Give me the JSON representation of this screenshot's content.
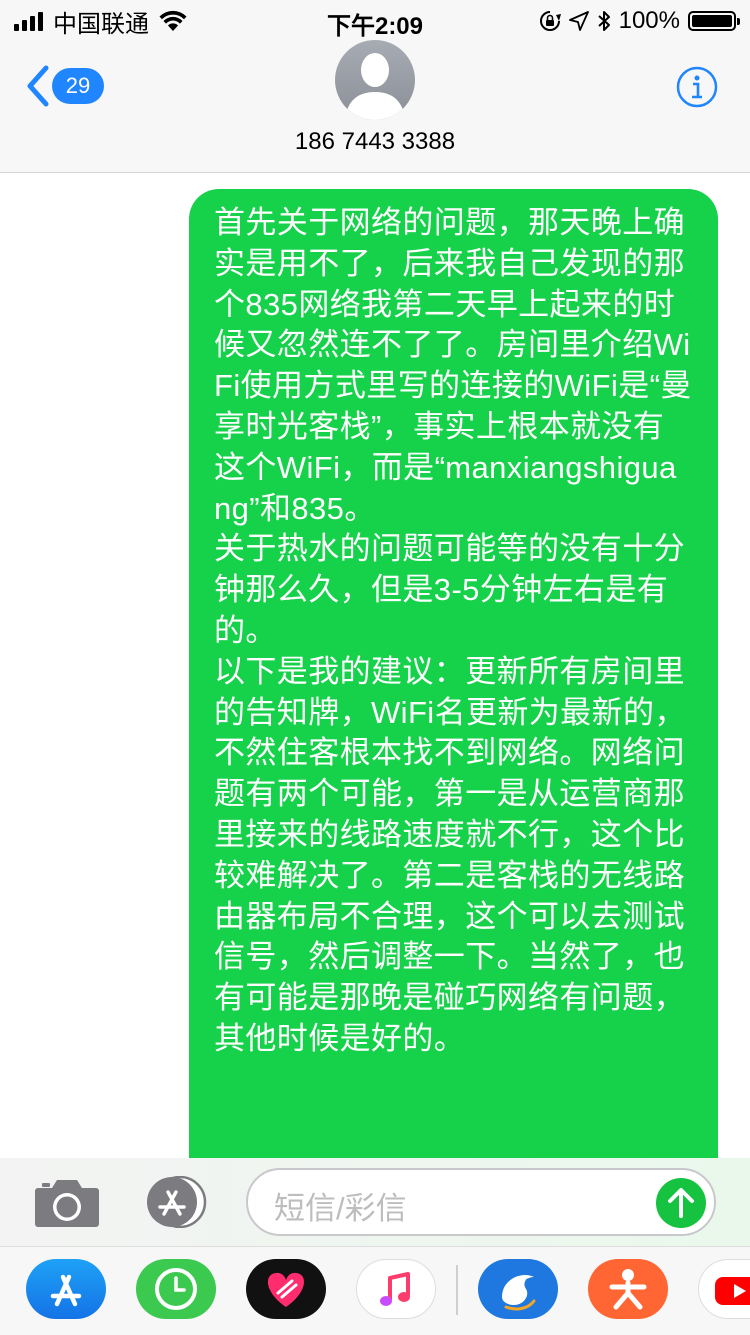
{
  "status_bar": {
    "carrier": "中国联通",
    "time": "下午2:09",
    "battery_percent": "100%"
  },
  "header": {
    "back_count": "29",
    "contact": "186 7443 3388"
  },
  "message": {
    "text": "首先关于网络的问题，那天晚上确实是用不了，后来我自己发现的那个835网络我第二天早上起来的时候又忽然连不了了。房间里介绍WiFi使用方式里写的连接的WiFi是“曼享时光客栈”，事实上根本就没有这个WiFi，而是“manxiangshiguang”和835。\n关于热水的问题可能等的没有十分钟那么久，但是3-5分钟左右是有的。\n以下是我的建议：更新所有房间里的告知牌，WiFi名更新为最新的，不然住客根本找不到网络。网络问题有两个可能，第一是从运营商那里接来的线路速度就不行，这个比较难解决了。第二是客栈的无线路由器布局不合理，这个可以去测试信号，然后调整一下。当然了，也有可能是那晚是碰巧网络有问题，其他时候是好的。",
    "bubble_color": "#16d14a"
  },
  "input": {
    "placeholder": "短信/彩信"
  },
  "app_drawer": {
    "apps": [
      "app-store",
      "clock",
      "digital-touch",
      "music",
      "ctrip",
      "dianping",
      "youtube"
    ]
  }
}
